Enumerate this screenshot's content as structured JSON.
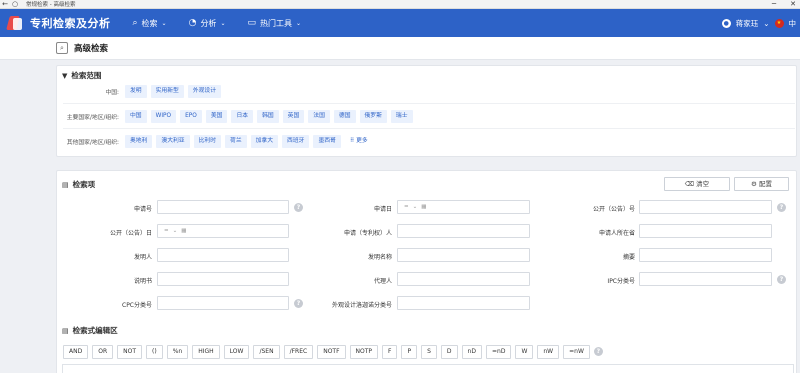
{
  "browser": {
    "tab_title": "常规检索 - 高级检索",
    "back_icon": "back-arrow-icon",
    "minimize": "─",
    "close": "✕"
  },
  "nav": {
    "app_title": "专利检索及分析",
    "menu": [
      {
        "label": "检索",
        "icon": "search-icon"
      },
      {
        "label": "分析",
        "icon": "chart-icon"
      },
      {
        "label": "热门工具",
        "icon": "monitor-icon"
      }
    ],
    "user_name": "蒋家珏",
    "lang": "中",
    "colors": {
      "primary": "#2d62c7",
      "accent": "#e84b4b"
    }
  },
  "page": {
    "title": "高级检索"
  },
  "scope": {
    "title": "检索范围",
    "rows": [
      {
        "label": "中国:",
        "chips": [
          "发明",
          "实用新型",
          "外观设计"
        ]
      },
      {
        "label": "主要国家/地区/组织:",
        "chips": [
          "中国",
          "WIPO",
          "EPO",
          "美国",
          "日本",
          "韩国",
          "英国",
          "法国",
          "德国",
          "俄罗斯",
          "瑞士"
        ]
      },
      {
        "label": "其他国家/地区/组织:",
        "chips": [
          "奥地利",
          "澳大利亚",
          "比利时",
          "荷兰",
          "加拿大",
          "西班牙",
          "墨西哥"
        ]
      }
    ],
    "more_label": "更多"
  },
  "items": {
    "title": "检索项",
    "clear_label": "清空",
    "config_label": "配置",
    "fields": {
      "application_no": "申请号",
      "application_date": "申请日",
      "publication_no": "公开（公告）号",
      "publication_date": "公开（公告）日",
      "applicant": "申请（专利权）人",
      "applicant_location": "申请人所在省",
      "inventor": "发明人",
      "invention_name": "发明名称",
      "abstract": "摘要",
      "description": "说明书",
      "agent": "代理人",
      "ipc": "IPC分类号",
      "cpc": "CPC分类号",
      "locarno": "外观设计洛迦诺分类号"
    },
    "date_operator": "=",
    "date_placeholder_icon": "calendar-icon"
  },
  "editor": {
    "title": "检索式编辑区",
    "operators": [
      "AND",
      "OR",
      "NOT",
      "()",
      "%n",
      "HIGH",
      "LOW",
      "/SEN",
      "/FREC",
      "NOTF",
      "NOTP",
      "F",
      "P",
      "S",
      "D",
      "nD",
      "=nD",
      "W",
      "nW",
      "=nW"
    ]
  }
}
